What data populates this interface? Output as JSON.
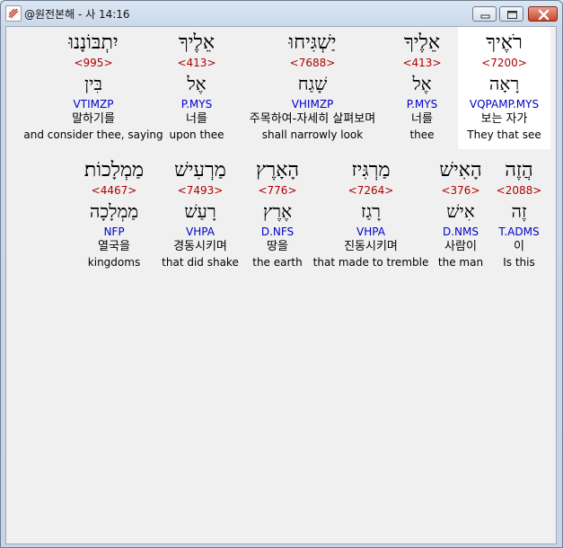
{
  "window": {
    "title": "@원전본해 - 사 14:16"
  },
  "colors": {
    "number": "#b00000",
    "parsing": "#0000c8",
    "text": "#000000",
    "selected_bg": "#ffffff"
  },
  "rows": [
    {
      "words": [
        {
          "heb": "רֹאֶיךָ",
          "num": "<7200>",
          "lemma": "רָאָה",
          "parse": "VQPAMP.MYS",
          "kor": "보는 자가",
          "eng": "They that see",
          "selected": true
        },
        {
          "heb": "אֵלֶיךָ",
          "num": "<413>",
          "lemma": "אֶל",
          "parse": "P.MYS",
          "kor": "너를",
          "eng": "thee"
        },
        {
          "heb": "יַשְׁגִּיחוּ",
          "num": "<7688>",
          "lemma": "שָׁגַח",
          "parse": "VHIMZP",
          "kor": "주목하여-자세히 살펴보며",
          "eng": "shall narrowly look"
        },
        {
          "heb": "אֵלֶיךָ",
          "num": "<413>",
          "lemma": "אֶל",
          "parse": "P.MYS",
          "kor": "너를",
          "eng": "upon thee"
        },
        {
          "heb": "יִתְבּוֹנָנוּ",
          "num": "<995>",
          "lemma": "בִּין",
          "parse": "VTIMZP",
          "kor": "말하기를",
          "eng": "and consider thee, saying"
        }
      ]
    },
    {
      "words": [
        {
          "heb": "הֲזֶה",
          "num": "<2088>",
          "lemma": "זֶה",
          "parse": "T.ADMS",
          "kor": "이",
          "eng": "Is this"
        },
        {
          "heb": "הָאִישׁ",
          "num": "<376>",
          "lemma": "אִישׁ",
          "parse": "D.NMS",
          "kor": "사람이",
          "eng": "the man"
        },
        {
          "heb": "מַרְגִּיז",
          "num": "<7264>",
          "lemma": "רָגַז",
          "parse": "VHPA",
          "kor": "진동시키며",
          "eng": "that made to tremble"
        },
        {
          "heb": "הָאָרֶץ",
          "num": "<776>",
          "lemma": "אֶרֶץ",
          "parse": "D.NFS",
          "kor": "땅을",
          "eng": "the earth"
        },
        {
          "heb": "מַרְעִישׁ",
          "num": "<7493>",
          "lemma": "רָעַשׁ",
          "parse": "VHPA",
          "kor": "경동시키며",
          "eng": "that did shake"
        },
        {
          "heb": "מַמְלָכוֹת׃",
          "num": "<4467>",
          "lemma": "מַמְלָכָה",
          "parse": "NFP",
          "kor": "열국을",
          "eng": "kingdoms"
        }
      ]
    }
  ]
}
